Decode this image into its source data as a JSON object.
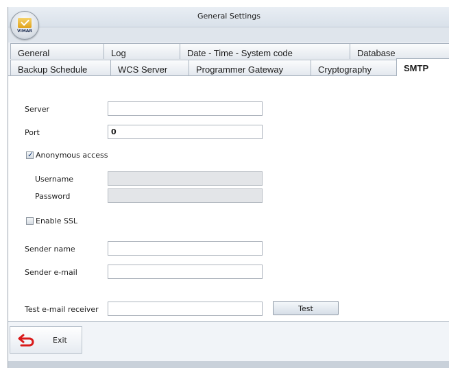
{
  "window": {
    "title": "General Settings",
    "logo_text": "VIMAR"
  },
  "tabs_row1": [
    "General",
    "Log",
    "Date - Time - System code",
    "Database"
  ],
  "tabs_row2": [
    "Backup Schedule",
    "WCS Server",
    "Programmer Gateway",
    "Cryptography",
    "SMTP"
  ],
  "active_tab": "SMTP",
  "form": {
    "server_label": "Server",
    "server_value": "",
    "port_label": "Port",
    "port_value": "0",
    "anonymous_label": "Anonymous access",
    "anonymous_checked": true,
    "username_label": "Username",
    "username_value": "",
    "password_label": "Password",
    "password_value": "",
    "ssl_label": "Enable SSL",
    "ssl_checked": false,
    "sender_name_label": "Sender name",
    "sender_name_value": "",
    "sender_email_label": "Sender e-mail",
    "sender_email_value": "",
    "test_receiver_label": "Test e-mail receiver",
    "test_receiver_value": "",
    "test_button": "Test"
  },
  "footer": {
    "exit_label": "Exit"
  },
  "colors": {
    "exit_icon": "#d91a1a",
    "accent_border": "#a8b3bf"
  }
}
